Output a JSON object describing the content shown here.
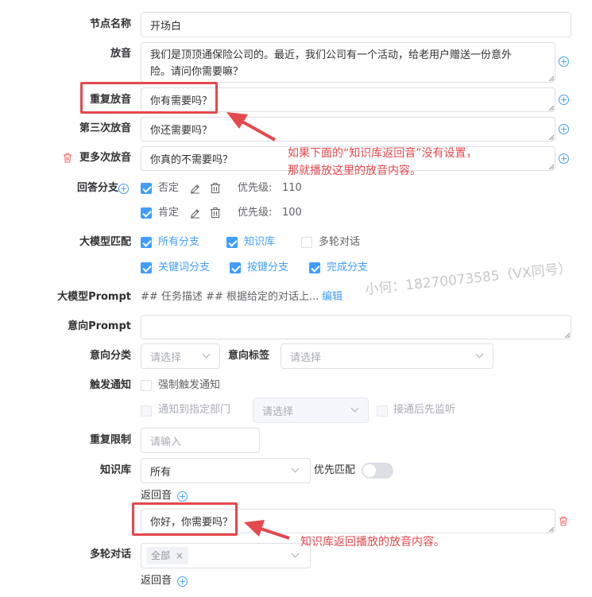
{
  "labels": {
    "node_name": "节点名称",
    "play": "放音",
    "repeat_play": "重复放音",
    "third_play": "第三次放音",
    "more_play": "更多次放音",
    "answer_branch": "回答分支",
    "llm_match": "大模型匹配",
    "llm_prompt": "大模型Prompt",
    "intent_prompt": "意向Prompt",
    "intent_class": "意向分类",
    "intent_tag": "意向标签",
    "trigger_notify": "触发通知",
    "repeat_limit": "重复限制",
    "knowledge": "知识库",
    "priority_match": "优先匹配",
    "return_audio": "返回音",
    "multi_dialog": "多轮对话"
  },
  "fields": {
    "node_name": "开场白",
    "play_line1": "我们是顶顶通保险公司的。最近，我们公司有一个活动，给老用户赠送一份意外",
    "play_line2": "险。请问你需要嘛？",
    "repeat_play": "你有需要吗？",
    "third_play": "你还需要吗？",
    "more_play": "你真的不需要吗？",
    "prompt_preview": "## 任务描述 ## 根据给定的对话上...",
    "prompt_edit": "编辑",
    "select_placeholder": "请选择",
    "input_placeholder": "请输入",
    "knowledge_value": "所有",
    "return_text": "你好，你需要吗？",
    "multi_tag": "全部"
  },
  "branches": [
    {
      "name": "否定",
      "priority_label": "优先级:",
      "priority": "110"
    },
    {
      "name": "肯定",
      "priority_label": "优先级:",
      "priority": "100"
    }
  ],
  "llm_options": {
    "all_branches": "所有分支",
    "knowledge": "知识库",
    "multi_dialog": "多轮对话",
    "keyword_branch": "关键词分支",
    "key_branch": "按键分支",
    "finish_branch": "完成分支"
  },
  "notify": {
    "force": "强制触发通知",
    "to_dept": "通知到指定部门",
    "listen_first": "接通后先监听"
  },
  "annotations": {
    "note1_line1": "如果下面的“知识库返回音”没有设置，",
    "note1_line2": "那就播放这里的放音内容。",
    "note2": "知识库返回播放的放音内容。",
    "watermark": "小何：18270073585（VX同号）"
  },
  "colors": {
    "accent": "#409eff",
    "annotation": "#e5484d",
    "delete": "#f56c6c"
  }
}
